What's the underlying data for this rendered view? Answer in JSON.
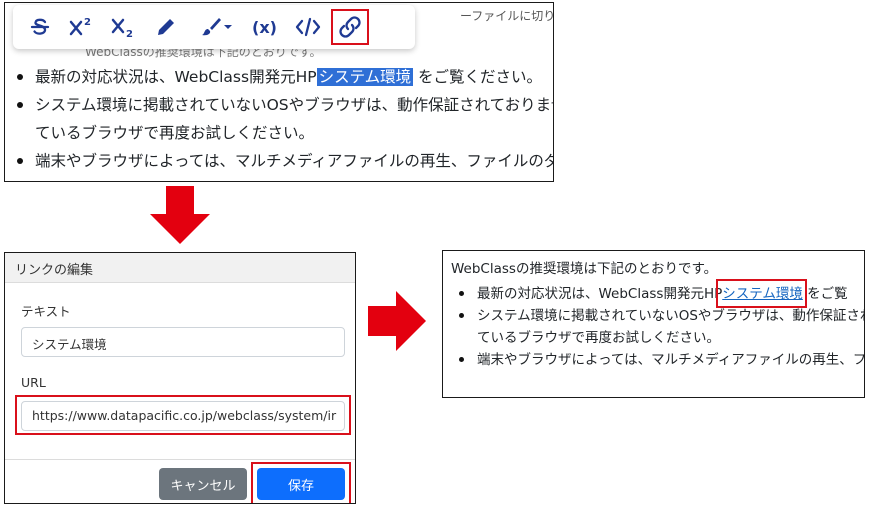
{
  "colors": {
    "accent_red": "#d9101b",
    "toolbar_icon": "#1f3a93",
    "selection": "#2f6fd6",
    "cancel_button": "#6c757d",
    "save_button": "#0d6efd",
    "link": "#1565c0"
  },
  "editor": {
    "background_snippet": "ーファイルに切り替え",
    "background_snippet2": "WebClassの推奨環境は下記のとおりです。",
    "toolbar": [
      {
        "name": "strikethrough-icon",
        "glyph": "S"
      },
      {
        "name": "superscript-icon",
        "glyph": "X²"
      },
      {
        "name": "subscript-icon",
        "glyph": "X₂"
      },
      {
        "name": "pen-icon",
        "glyph": "pen"
      },
      {
        "name": "brush-dropdown-icon",
        "glyph": "brush"
      },
      {
        "name": "variable-icon",
        "glyph": "(x)"
      },
      {
        "name": "code-icon",
        "glyph": "</>"
      },
      {
        "name": "link-icon",
        "glyph": "link"
      }
    ],
    "items": {
      "item1_before": "最新の対応状況は、WebClass開発元HP",
      "item1_selected": "システム環境",
      "item1_after": " をご覧ください。",
      "item2_line1": "システム環境に掲載されていないOSやブラウザは、動作保証されておりません。",
      "item2_line2": "ているブラウザで再度お試しください。",
      "item3": "端末やブラウザによっては、マルチメディアファイルの再生、ファイルのダウンロード"
    }
  },
  "dialog": {
    "title": "リンクの編集",
    "text_label": "テキスト",
    "text_value": "システム環境",
    "url_label": "URL",
    "url_value": "https://www.datapacific.co.jp/webclass/system/ir",
    "cancel_label": "キャンセル",
    "save_label": "保存"
  },
  "result": {
    "intro": "WebClassの推奨環境は下記のとおりです。",
    "item1_before": "最新の対応状況は、WebClass開発元HP",
    "item1_link": "システム環境",
    "item1_after": " をご覧",
    "item2_line1": "システム環境に掲載されていないOSやブラウザは、動作保証され",
    "item2_line2": "ているブラウザで再度お試しください。",
    "item3": "端末やブラウザによっては、マルチメディアファイルの再生、ファイル"
  }
}
